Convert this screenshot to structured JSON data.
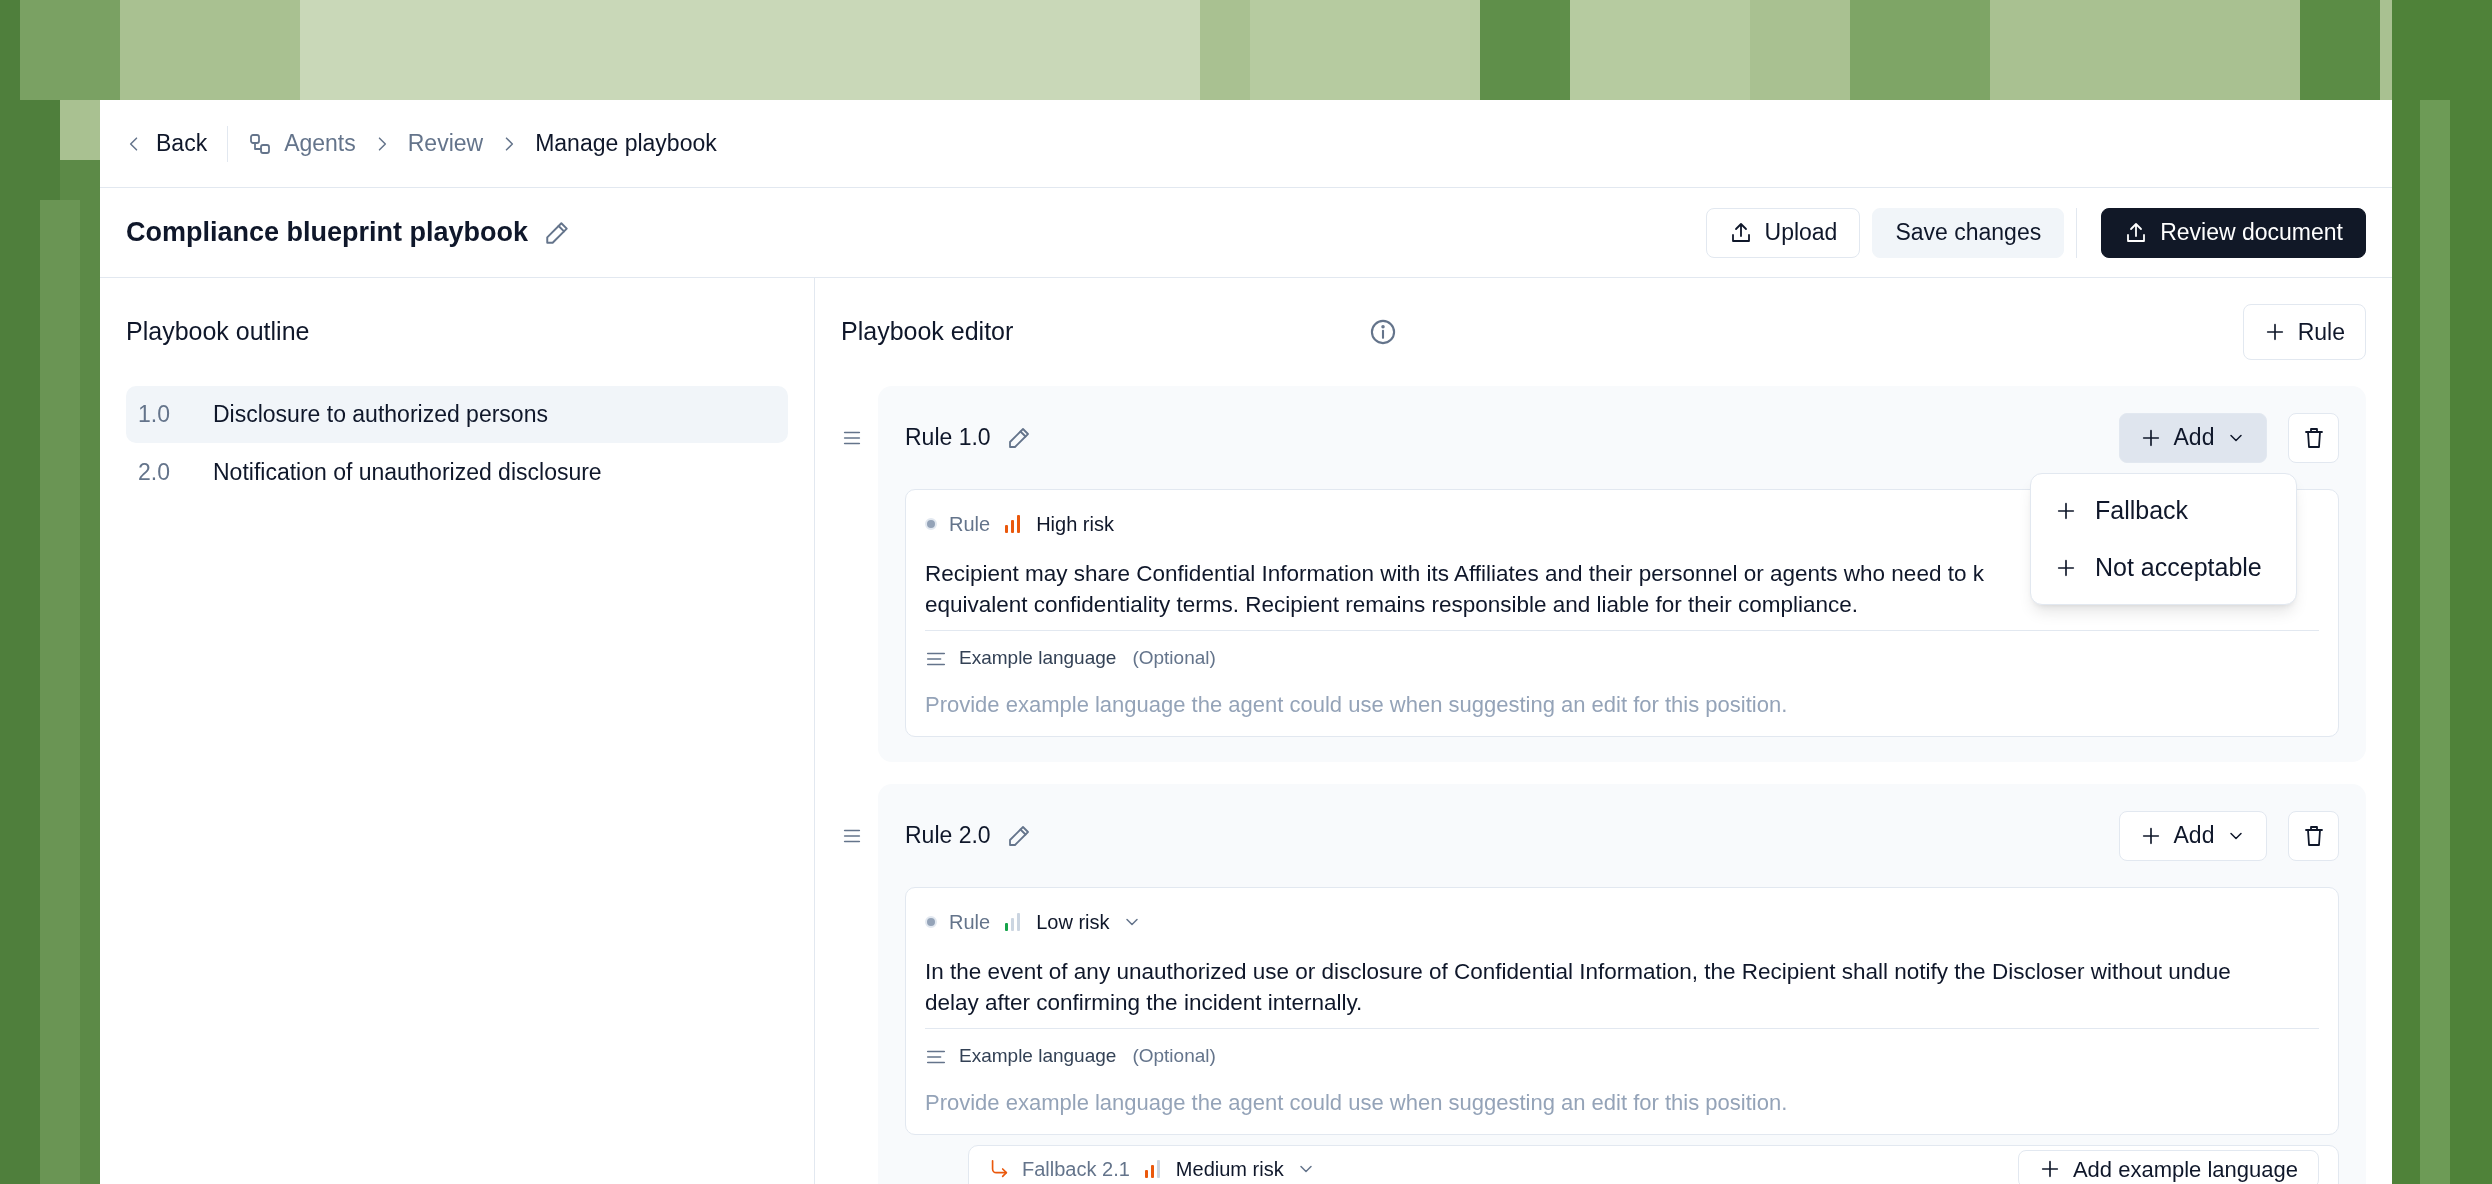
{
  "breadcrumb": {
    "back": "Back",
    "items": [
      {
        "label": "Agents",
        "kind": "agents",
        "current": false
      },
      {
        "label": "Review",
        "kind": "plain",
        "current": false
      },
      {
        "label": "Manage playbook",
        "kind": "plain",
        "current": true
      }
    ]
  },
  "title": "Compliance blueprint playbook",
  "actions": [
    {
      "label": "Upload",
      "kind": "upload"
    },
    {
      "label": "Save changes",
      "kind": "secondary"
    },
    {
      "label": "Review document",
      "kind": "primary"
    }
  ],
  "outline": {
    "title": "Playbook outline",
    "items": [
      {
        "number": "1.0",
        "label": "Disclosure to authorized persons",
        "selected": true
      },
      {
        "number": "2.0",
        "label": "Notification of unauthorized disclosure",
        "selected": false
      }
    ]
  },
  "editor": {
    "title": "Playbook editor",
    "add_rule": "Rule",
    "rules": [
      {
        "title": "Rule 1.0",
        "add_label": "Add",
        "add_open": true,
        "type_label": "Rule",
        "risk": {
          "label": "High risk",
          "kind": "high",
          "dropdown": false
        },
        "lines": [
          "Recipient may share Confidential Information with its Affiliates and their personnel or agents who need to k",
          "equivalent confidentiality terms. Recipient remains responsible and liable for their compliance."
        ],
        "example_label": "Example language",
        "optional": "(Optional)",
        "placeholder": "Provide example language the agent could use when suggesting an edit for this position.",
        "menu": [
          "Fallback",
          "Not acceptable"
        ]
      },
      {
        "title": "Rule 2.0",
        "add_label": "Add",
        "add_open": false,
        "type_label": "Rule",
        "risk": {
          "label": "Low risk",
          "kind": "low",
          "dropdown": true
        },
        "lines": [
          "In the event of any unauthorized use or disclosure of Confidential Information, the Recipient shall notify the Discloser without undue",
          "delay after confirming the incident internally."
        ],
        "example_label": "Example language",
        "optional": "(Optional)",
        "placeholder": "Provide example language the agent could use when suggesting an edit for this position.",
        "fallbacks": [
          {
            "title": "Fallback 2.1",
            "risk": {
              "label": "Medium risk",
              "kind": "medium",
              "dropdown": true
            },
            "button": "Add example language"
          }
        ]
      }
    ]
  }
}
